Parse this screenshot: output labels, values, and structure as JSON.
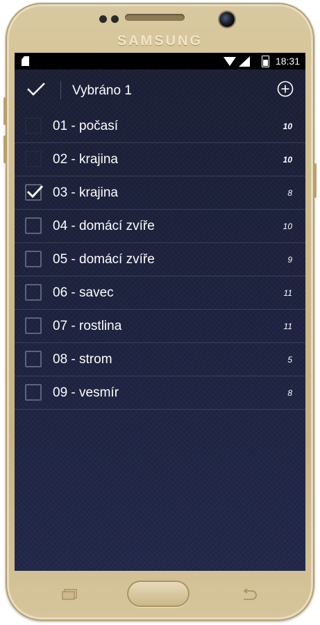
{
  "device": {
    "brand": "SAMSUNG"
  },
  "statusbar": {
    "time": "18:31"
  },
  "appbar": {
    "title": "Vybráno 1"
  },
  "list": {
    "items": [
      {
        "label": "01 - počasí",
        "count": "10",
        "checked": false
      },
      {
        "label": "02 - krajina",
        "count": "10",
        "checked": false
      },
      {
        "label": "03 - krajina",
        "count": "8",
        "checked": true
      },
      {
        "label": "04 - domácí zvíře",
        "count": "10",
        "checked": false
      },
      {
        "label": "05 - domácí zvíře",
        "count": "9",
        "checked": false
      },
      {
        "label": "06 - savec",
        "count": "11",
        "checked": false
      },
      {
        "label": "07 - rostlina",
        "count": "11",
        "checked": false
      },
      {
        "label": "08 - strom",
        "count": "5",
        "checked": false
      },
      {
        "label": "09 - vesmír",
        "count": "8",
        "checked": false
      }
    ]
  },
  "colors": {
    "screen_bg": "#1e2340",
    "checkbox_border": "#5e6478",
    "device_gold": "#cdb98a"
  },
  "icons": {
    "confirm": "check-icon",
    "add": "add-circle-icon"
  }
}
